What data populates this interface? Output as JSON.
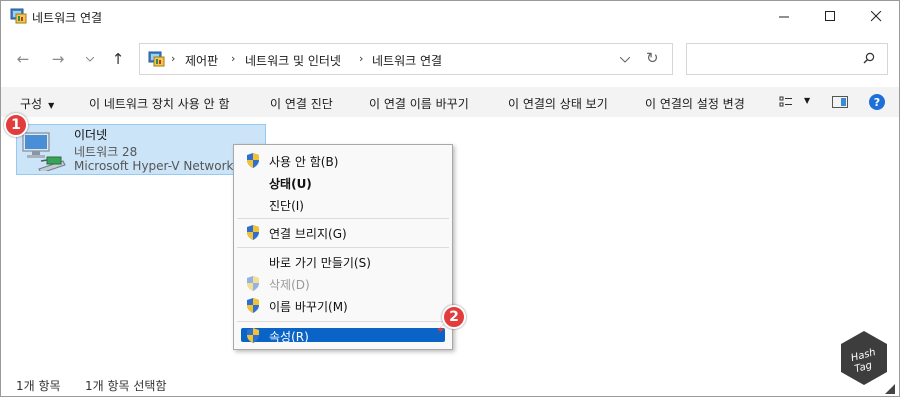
{
  "window": {
    "title": "네트워크 연결",
    "controls": {
      "minimize": "—",
      "maximize": "☐",
      "close": "✕"
    }
  },
  "nav": {
    "back": "←",
    "forward": "→",
    "recent": "⌄",
    "up": "↑"
  },
  "address": {
    "breadcrumbs": [
      "제어판",
      "네트워크 및 인터넷",
      "네트워크 연결"
    ],
    "separator": "›",
    "dropdown": "⌄",
    "refresh": "↻"
  },
  "search": {
    "placeholder": ""
  },
  "toolbar": {
    "organize": "구성",
    "commands": [
      "이 네트워크 장치 사용 안 함",
      "이 연결 진단",
      "이 연결 이름 바꾸기",
      "이 연결의 상태 보기",
      "이 연결의 설정 변경"
    ],
    "help": "?"
  },
  "item": {
    "name": "이더넷",
    "network": "네트워크 28",
    "adapter": "Microsoft Hyper-V Network Adapter"
  },
  "badges": [
    "1",
    "2"
  ],
  "context_menu": {
    "items": [
      {
        "label": "사용 안 함(B)",
        "shield": true
      },
      {
        "label": "상태(U)",
        "bold": true
      },
      {
        "label": "진단(I)"
      },
      {
        "label": "연결 브리지(G)",
        "shield": true
      },
      {
        "label": "바로 가기 만들기(S)"
      },
      {
        "label": "삭제(D)",
        "shield": true,
        "disabled": true
      },
      {
        "label": "이름 바꾸기(M)",
        "shield": true
      },
      {
        "label": "속성(R)",
        "shield": true,
        "selected": true
      }
    ]
  },
  "status": {
    "count": "1개 항목",
    "selected": "1개 항목 선택함"
  },
  "colors": {
    "accent": "#0a64c8",
    "selection": "#cce4f7",
    "badge": "#e33c3c",
    "help": "#1e70d8"
  },
  "icons": [
    "control-panel-icon",
    "network-adapter-icon",
    "uac-shield-icon",
    "search-icon",
    "help-icon",
    "hashtag-watermark"
  ]
}
